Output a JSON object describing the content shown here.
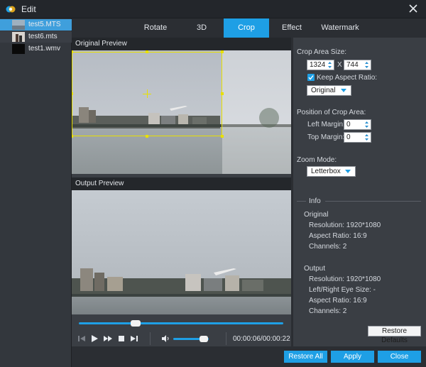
{
  "window": {
    "title": "Edit"
  },
  "files": [
    {
      "name": "test5.MTS",
      "selected": true
    },
    {
      "name": "test6.mts",
      "selected": false
    },
    {
      "name": "test1.wmv",
      "selected": false
    }
  ],
  "tabs": [
    {
      "label": "Rotate",
      "active": false
    },
    {
      "label": "3D",
      "active": false
    },
    {
      "label": "Crop",
      "active": true
    },
    {
      "label": "Effect",
      "active": false
    },
    {
      "label": "Watermark",
      "active": false
    }
  ],
  "preview": {
    "original_label": "Original Preview",
    "output_label": "Output Preview"
  },
  "player": {
    "timecode": "00:00:06/00:00:22",
    "seek_fraction": 0.27,
    "volume_fraction": 0.8
  },
  "crop": {
    "area_size_label": "Crop Area Size:",
    "width": "1324",
    "times": "X",
    "height": "744",
    "keep_aspect_label": "Keep Aspect Ratio:",
    "keep_aspect_checked": true,
    "aspect_value": "Original",
    "position_label": "Position of Crop Area:",
    "left_margin_label": "Left Margin:",
    "left_margin": "0",
    "top_margin_label": "Top Margin:",
    "top_margin": "0",
    "zoom_mode_label": "Zoom Mode:",
    "zoom_mode": "Letterbox"
  },
  "info": {
    "title": "Info",
    "original_title": "Original",
    "original": {
      "resolution": "Resolution: 1920*1080",
      "aspect": "Aspect Ratio: 16:9",
      "channels": "Channels: 2"
    },
    "output_title": "Output",
    "output": {
      "resolution": "Resolution: 1920*1080",
      "eye": "Left/Right Eye Size: -",
      "aspect": "Aspect Ratio: 16:9",
      "channels": "Channels: 2"
    }
  },
  "buttons": {
    "restore_defaults": "Restore Defaults",
    "restore_all": "Restore All",
    "apply": "Apply",
    "close": "Close"
  },
  "colors": {
    "accent": "#1e9fe5",
    "crop_frame": "#e8e000"
  }
}
